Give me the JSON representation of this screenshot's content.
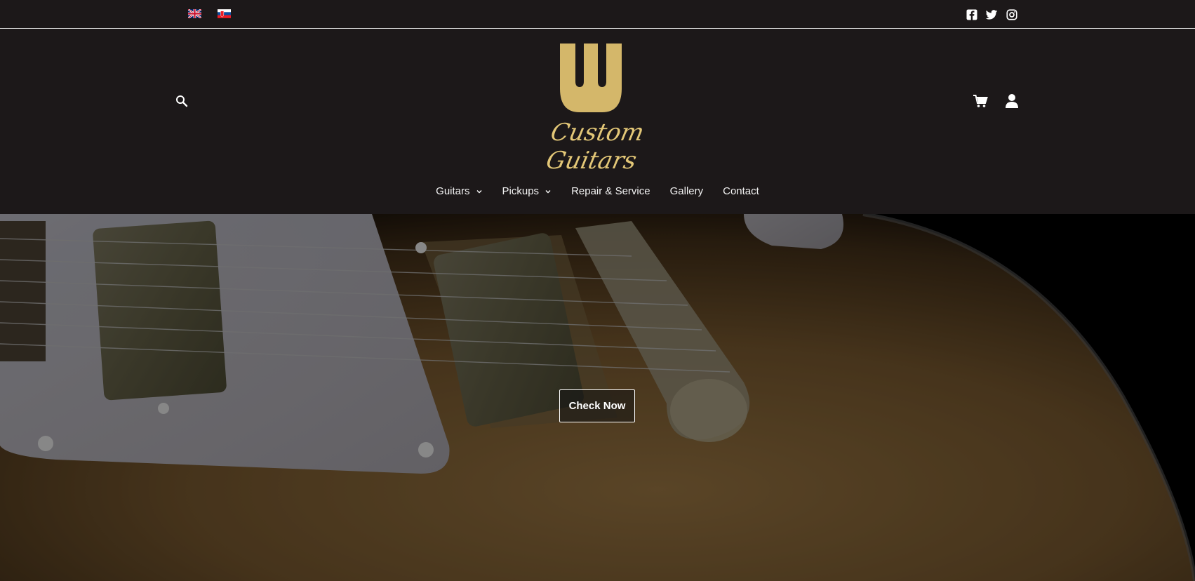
{
  "topbar": {
    "languages": [
      {
        "code": "en",
        "icon": "flag-uk-icon"
      },
      {
        "code": "sk",
        "icon": "flag-slovakia-icon"
      }
    ],
    "social": [
      "facebook-icon",
      "twitter-icon",
      "instagram-icon"
    ]
  },
  "header": {
    "logo_text": "Custom Guitars",
    "brand_color": "#d4b76a"
  },
  "nav": {
    "items": [
      {
        "label": "Guitars",
        "dropdown": true
      },
      {
        "label": "Pickups",
        "dropdown": true
      },
      {
        "label": "Repair & Service",
        "dropdown": false
      },
      {
        "label": "Gallery",
        "dropdown": false
      },
      {
        "label": "Contact",
        "dropdown": false
      }
    ]
  },
  "hero": {
    "button_label": "Check Now"
  },
  "colors": {
    "background": "#1c1819",
    "accent": "#d4b76a"
  }
}
